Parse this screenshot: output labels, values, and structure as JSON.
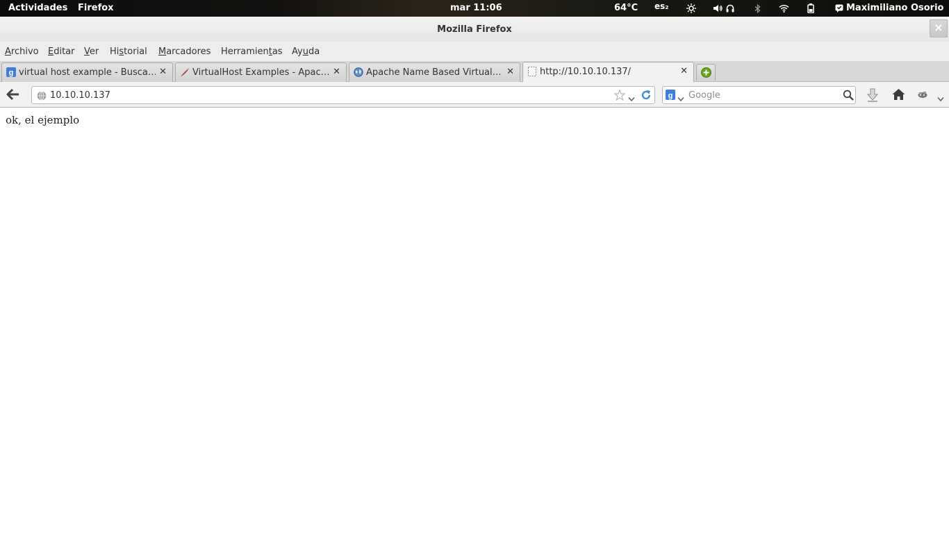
{
  "topbar": {
    "activities": "Actividades",
    "app_name": "Firefox",
    "clock": "mar 11:06",
    "temperature": "64°C",
    "keyboard_layout": "es₂",
    "user_name": "Maximiliano Osorio"
  },
  "window": {
    "title": "Mozilla Firefox"
  },
  "menu": {
    "items": [
      {
        "pre": "",
        "key": "A",
        "post": "rchivo"
      },
      {
        "pre": "",
        "key": "E",
        "post": "ditar"
      },
      {
        "pre": "",
        "key": "V",
        "post": "er"
      },
      {
        "pre": "Hi",
        "key": "s",
        "post": "torial"
      },
      {
        "pre": "",
        "key": "M",
        "post": "arcadores"
      },
      {
        "pre": "Herramien",
        "key": "t",
        "post": "as"
      },
      {
        "pre": "Ay",
        "key": "u",
        "post": "da"
      }
    ]
  },
  "tabs": [
    {
      "label": "virtual host example - Busca…",
      "favicon": "google-icon",
      "active": false
    },
    {
      "label": "VirtualHost Examples - Apac…",
      "favicon": "apache-feather-icon",
      "active": false
    },
    {
      "label": "Apache Name Based Virtual…",
      "favicon": "globe-icon",
      "active": false
    },
    {
      "label": "http://10.10.10.137/",
      "favicon": "blank-page-icon",
      "active": true
    }
  ],
  "navbar": {
    "url": "10.10.10.137",
    "search_placeholder": "Google"
  },
  "page": {
    "text": "ok, el ejemplo"
  },
  "colors": {
    "topbar_bg": "#151310",
    "chrome_bg": "#ededed",
    "new_tab_green": "#6aa31b",
    "google_blue": "#3f7fdc"
  }
}
